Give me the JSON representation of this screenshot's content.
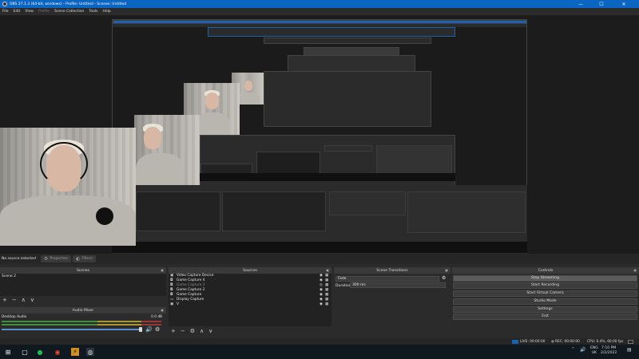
{
  "window": {
    "title": "OBS 27.1.3 (64-bit, windows) - Profile: Untitled - Scenes: Untitled",
    "minimize": "—",
    "maximize": "☐",
    "close": "✕"
  },
  "menu": [
    "File",
    "Edit",
    "View",
    "Profile",
    "Scene Collection",
    "Tools",
    "Help"
  ],
  "source_bar": {
    "status": "No source selected",
    "properties": "Properties",
    "filters": "Filters"
  },
  "scenes": {
    "title": "Scenes",
    "items": [
      "Scene 2"
    ],
    "toolbar": [
      "+",
      "−",
      "∧",
      "∨"
    ]
  },
  "audio_mixer": {
    "title": "Audio Mixer",
    "track_name": "Desktop Audio",
    "level": "0.0 dB"
  },
  "sources": {
    "title": "Sources",
    "items": [
      {
        "label": "Video Capture Device",
        "icon": "camera-icon",
        "dim": false
      },
      {
        "label": "Game Capture 4",
        "icon": "gamepad-icon",
        "dim": false
      },
      {
        "label": "Game Capture 3",
        "icon": "gamepad-icon",
        "dim": true
      },
      {
        "label": "Game Capture 2",
        "icon": "gamepad-icon",
        "dim": false
      },
      {
        "label": "Game Capture",
        "icon": "gamepad-icon",
        "dim": false
      },
      {
        "label": "Display Capture",
        "icon": "monitor-icon",
        "dim": false
      },
      {
        "label": "V",
        "icon": "camera-icon",
        "dim": false
      }
    ],
    "toolbar": [
      "+",
      "−",
      "⚙",
      "∧",
      "∨"
    ]
  },
  "scene_transitions": {
    "title": "Scene Transitions",
    "transition": "Fade",
    "duration_label": "Duration",
    "duration_value": "300 ms"
  },
  "controls": {
    "title": "Controls",
    "buttons": [
      "Stop Streaming",
      "Start Recording",
      "Start Virtual Camera",
      "Studio Mode",
      "Settings",
      "Exit"
    ]
  },
  "status": {
    "live": "LIVE: 00:00:00",
    "rec": "REC: 00:00:00",
    "cpu": "CPU: 0.4%, 60.00 fps"
  },
  "taskbar": {
    "lang": "ENG",
    "region": "UK",
    "time": "7:10 PM",
    "date": "2/2/2022"
  },
  "colors": {
    "accent": "#0a66c2",
    "meter_green": "#4fb34f",
    "meter_yellow": "#c8b23a",
    "meter_red": "#c04040"
  }
}
